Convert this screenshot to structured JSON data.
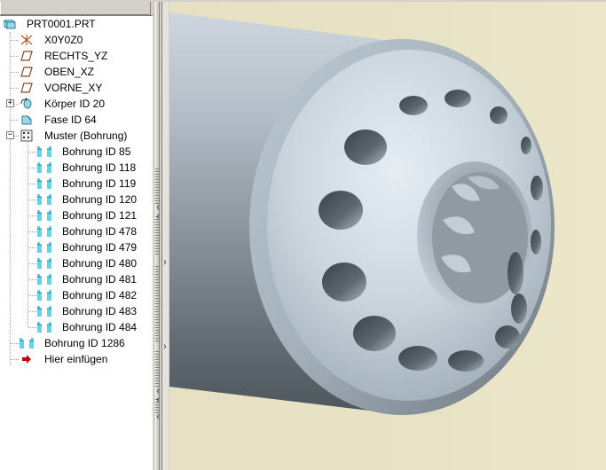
{
  "model_tree": {
    "root": {
      "label": "PRT0001.PRT",
      "icon": "part-icon"
    },
    "items": [
      {
        "label": "X0Y0Z0",
        "icon": "coordinate-system-icon",
        "level": 1,
        "expander": ""
      },
      {
        "label": "RECHTS_YZ",
        "icon": "datum-plane-icon",
        "level": 1,
        "expander": ""
      },
      {
        "label": "OBEN_XZ",
        "icon": "datum-plane-icon",
        "level": 1,
        "expander": ""
      },
      {
        "label": "VORNE_XY",
        "icon": "datum-plane-icon",
        "level": 1,
        "expander": ""
      },
      {
        "label": "Körper ID 20",
        "icon": "revolve-feature-icon",
        "level": 1,
        "expander": "+"
      },
      {
        "label": "Fase ID 64",
        "icon": "chamfer-icon",
        "level": 1,
        "expander": ""
      },
      {
        "label": "Muster (Bohrung)",
        "icon": "pattern-icon",
        "level": 1,
        "expander": "−"
      },
      {
        "label": "Bohrung ID 85",
        "icon": "hole-icon",
        "level": 2,
        "expander": ""
      },
      {
        "label": "Bohrung ID 118",
        "icon": "hole-icon",
        "level": 2,
        "expander": ""
      },
      {
        "label": "Bohrung ID 119",
        "icon": "hole-icon",
        "level": 2,
        "expander": ""
      },
      {
        "label": "Bohrung ID 120",
        "icon": "hole-icon",
        "level": 2,
        "expander": ""
      },
      {
        "label": "Bohrung ID 121",
        "icon": "hole-icon",
        "level": 2,
        "expander": ""
      },
      {
        "label": "Bohrung ID 478",
        "icon": "hole-icon",
        "level": 2,
        "expander": ""
      },
      {
        "label": "Bohrung ID 479",
        "icon": "hole-icon",
        "level": 2,
        "expander": ""
      },
      {
        "label": "Bohrung ID 480",
        "icon": "hole-icon",
        "level": 2,
        "expander": ""
      },
      {
        "label": "Bohrung ID 481",
        "icon": "hole-icon",
        "level": 2,
        "expander": ""
      },
      {
        "label": "Bohrung ID 482",
        "icon": "hole-icon",
        "level": 2,
        "expander": ""
      },
      {
        "label": "Bohrung ID 483",
        "icon": "hole-icon",
        "level": 2,
        "expander": ""
      },
      {
        "label": "Bohrung ID 484",
        "icon": "hole-icon",
        "level": 2,
        "expander": ""
      },
      {
        "label": "Bohrung ID 1286",
        "icon": "hole-icon",
        "level": 1,
        "expander": ""
      },
      {
        "label": "Hier einfügen",
        "icon": "insert-here-arrow-icon",
        "level": 1,
        "expander": ""
      }
    ]
  },
  "colors": {
    "viewport_background": "#e9e3c6",
    "part_surface": "#b9c6d0",
    "part_shadow": "#5d6770",
    "insert_arrow": "#c00000",
    "splitter_arrow": "#1d2f9a"
  },
  "splitter": {
    "arrows": [
      "‹",
      "‹",
      "›",
      "›",
      "‹",
      "‹",
      "‹"
    ]
  }
}
